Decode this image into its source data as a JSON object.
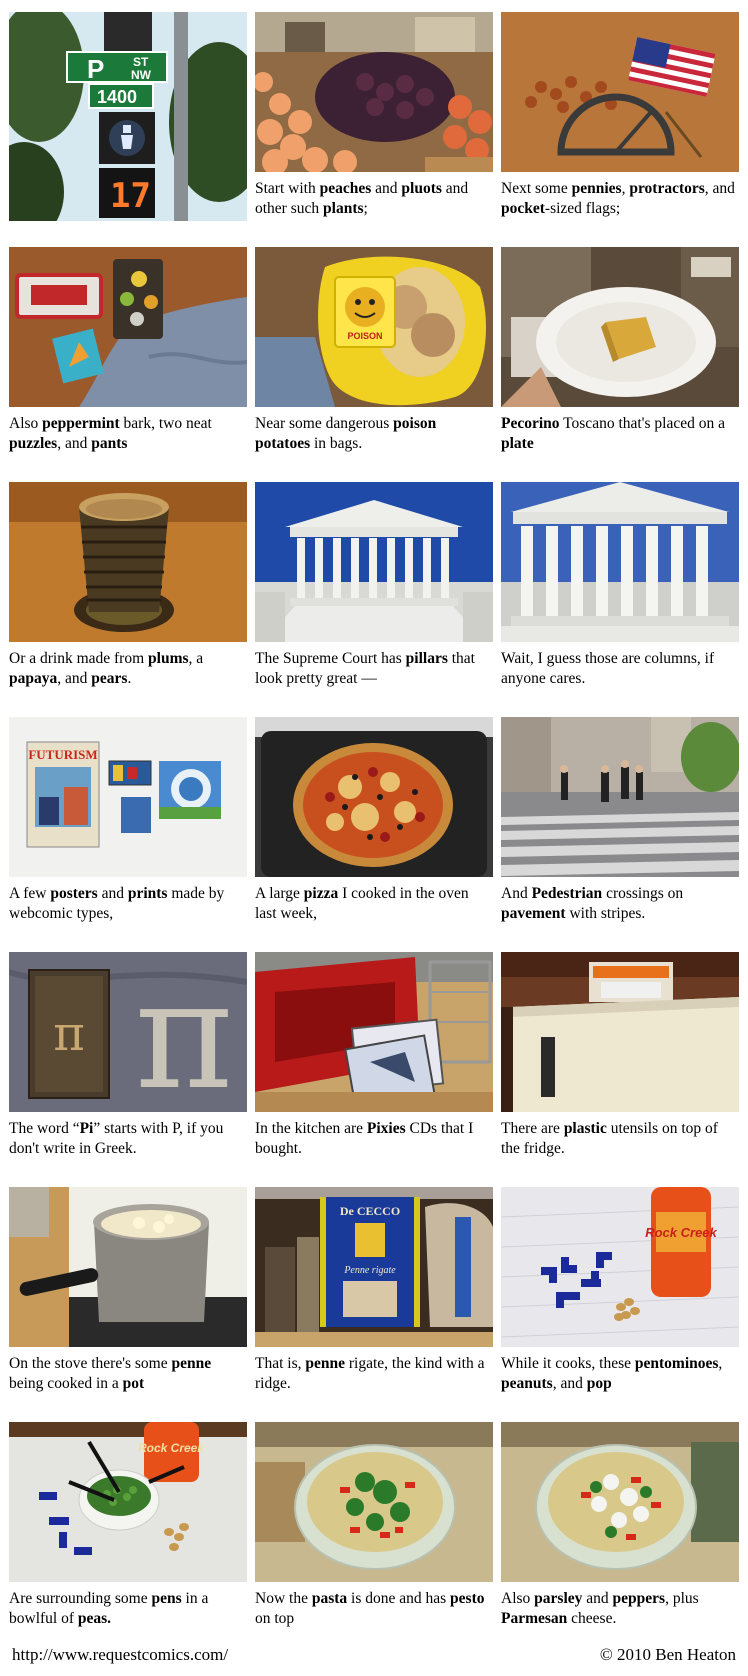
{
  "panels": [
    {
      "photo": "street-sign-photo",
      "caption_html": "",
      "sign": {
        "letter": "P",
        "st": "ST",
        "nw": "NW",
        "num": "1400"
      },
      "signal_count": "17"
    },
    {
      "photo": "fruit-stand-photo",
      "caption_html": "Start with <b>peaches</b> and <b>pluots</b> and other such <b>plants</b>;"
    },
    {
      "photo": "pennies-flag-photo",
      "caption_html": "Next some <b>pennies</b>, <b>protractors</b>, and <b>pocket</b>-sized flags;"
    },
    {
      "photo": "peppermint-puzzles-photo",
      "caption_html": "Also <b>peppermint</b> bark, two neat <b>puzzles</b>, and <b>pants</b>"
    },
    {
      "photo": "poison-potatoes-photo",
      "caption_html": "Near some dangerous <b>poison potatoes</b> in bags.",
      "bag_label": "Im made of POISON"
    },
    {
      "photo": "pecorino-plate-photo",
      "caption_html": "<b>Pecorino</b> Toscano that's placed on a <b>plate</b>"
    },
    {
      "photo": "drink-glass-photo",
      "caption_html": "Or a drink made from <b>plums</b>, a <b>papaya</b>, and <b>pears</b>."
    },
    {
      "photo": "supreme-court-photo-1",
      "caption_html": "The Supreme Court has <b>pillars</b> that look pretty great —"
    },
    {
      "photo": "supreme-court-photo-2",
      "caption_html": "Wait, I guess those are columns, if anyone cares."
    },
    {
      "photo": "posters-prints-photo",
      "caption_html": "A few <b>posters</b> and <b>prints</b> made by webcomic types,",
      "poster_title": "FUTURISM"
    },
    {
      "photo": "pizza-photo",
      "caption_html": "A large <b>pizza</b> I cooked in the oven last week,"
    },
    {
      "photo": "crosswalk-photo",
      "caption_html": "And <b>Pedestrian</b> crossings on <b>pavement</b> with stripes."
    },
    {
      "photo": "pi-shirt-photo",
      "caption_html": "The word “<b>Pi</b>” starts with P, if you don't write in Greek.",
      "pi_symbol": "π"
    },
    {
      "photo": "pixies-cds-photo",
      "caption_html": "In the kitchen are <b>Pixies</b> CDs that I bought."
    },
    {
      "photo": "plastic-utensils-photo",
      "caption_html": "There are <b>plastic</b> utensils on top of the fridge."
    },
    {
      "photo": "stove-pot-photo",
      "caption_html": "On the stove there's some <b>penne</b> being cooked in a <b>pot</b>"
    },
    {
      "photo": "penne-box-photo",
      "caption_html": "That is, <b>penne</b> rigate, the kind with a ridge.",
      "box_brand": "De CECCO",
      "box_name": "Penne rigate"
    },
    {
      "photo": "pentominoes-pop-photo",
      "caption_html": "While it cooks, these <b>pentominoes</b>, <b>peanuts</b>, and <b>pop</b>",
      "soda_label": "Rock Creek"
    },
    {
      "photo": "pens-peas-photo",
      "caption_html": "Are surrounding some <b>pens</b> in a bowlful of <b>peas.</b>",
      "soda_label": "Rock Creek"
    },
    {
      "photo": "pasta-pesto-photo",
      "caption_html": "Now the <b>pasta</b> is done and has <b>pesto</b> on top"
    },
    {
      "photo": "parsley-peppers-photo",
      "caption_html": "Also <b>parsley</b> and <b>peppers</b>, plus <b>Parmesan</b> cheese."
    }
  ],
  "footer": {
    "url": "http://www.requestcomics.com/",
    "copyright": "© 2010 Ben Heaton"
  }
}
